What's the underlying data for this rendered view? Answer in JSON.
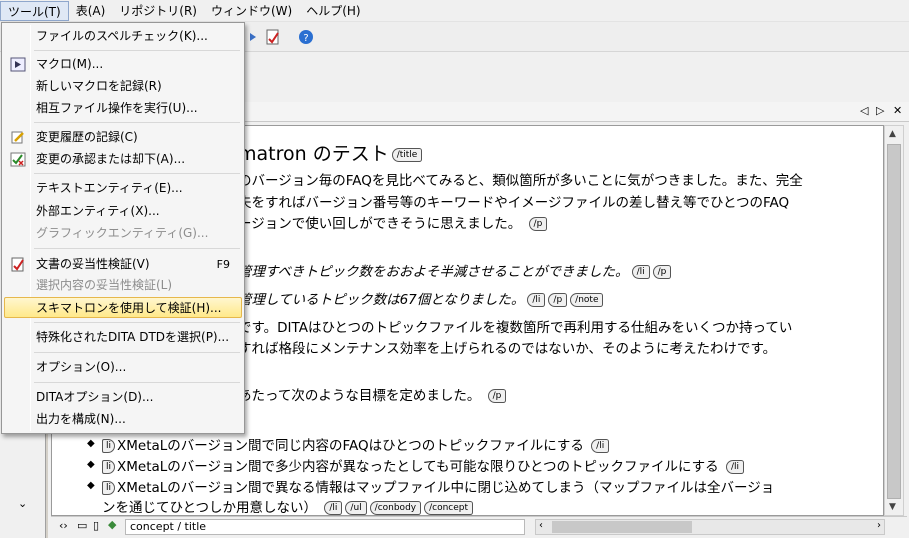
{
  "menubar": [
    {
      "label": "ツール(T)",
      "active": true
    },
    {
      "label": "表(A)"
    },
    {
      "label": "リポジトリ(R)"
    },
    {
      "label": "ウィンドウ(W)"
    },
    {
      "label": "ヘルプ(H)"
    }
  ],
  "tools_menu": {
    "items": [
      {
        "label": "ファイルのスペルチェック(K)..."
      },
      {
        "label": "マクロ(M)..."
      },
      {
        "label": "新しいマクロを記録(R)"
      },
      {
        "label": "相互ファイル操作を実行(U)..."
      },
      {
        "label": "変更履歴の記録(C)"
      },
      {
        "label": "変更の承認または却下(A)..."
      },
      {
        "label": "テキストエンティティ(E)..."
      },
      {
        "label": "外部エンティティ(X)..."
      },
      {
        "label": "グラフィックエンティティ(G)..."
      },
      {
        "label": "文書の妥当性検証(V)",
        "shortcut": "F9"
      },
      {
        "label": "選択内容の妥当性検証(L)"
      },
      {
        "label": "スキマトロンを使用して検証(H)..."
      },
      {
        "label": "特殊化されたDITA DTDを選択(P)..."
      },
      {
        "label": "オプション(O)..."
      },
      {
        "label": "DITAオプション(D)..."
      },
      {
        "label": "出力を構成(N)..."
      }
    ]
  },
  "editor": {
    "title_text": "matron のテスト",
    "title_tag": "/title",
    "p1_l1": "のバージョン毎のFAQを見比べてみると、類似箇所が多いことに気がつきました。また、完全",
    "p1_l2": "夫をすればバージョン番号等のキーワードやイメージファイルの差し替え等でひとつのFAQ",
    "p1_l3": "ージョンで使い回しができそうに思えました。",
    "tag_p": "/p",
    "note1": "管理すべきトピック数をおおよそ半減させることができました。",
    "tag_li": "/li",
    "note2": "管理しているトピック数は67個となりました。",
    "tag_note": "/note",
    "p2_l1": "です。DITAはひとつのトピックファイルを複数箇所で再利用する仕組みをいくつか持ってい",
    "p2_l2": "すれば格段にメンテナンス効率を上げられるのではないか、そのように考えたわけです。",
    "p3": "あたって次のような目標を定めました。",
    "li_open": "li",
    "li1": "XMetaLのバージョン間で同じ内容のFAQはひとつのトピックファイルにする",
    "li2": "XMetaLのバージョン間で多少内容が異なったとしても可能な限りひとつのトピックファイルにする",
    "li3_l1": "XMetaLのバージョン間で異なる情報はマップファイル中に閉じ込めてしまう（マップファイルは全バージョ",
    "li3_l2": "ンを通じてひとつしか用意しない）",
    "tag_ul": "/ul",
    "tag_conbody": "/conbody",
    "tag_concept": "/concept"
  },
  "statusbar": {
    "path": "concept / title"
  }
}
